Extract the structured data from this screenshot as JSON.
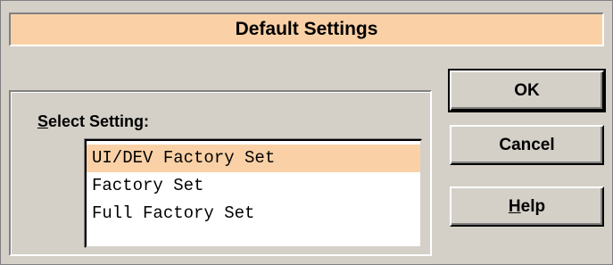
{
  "dialog": {
    "title": "Default Settings"
  },
  "select": {
    "label_mnemonic": "S",
    "label_rest": "elect Setting:",
    "items": [
      {
        "label": "UI/DEV Factory Set",
        "selected": true
      },
      {
        "label": "Factory Set",
        "selected": false
      },
      {
        "label": "Full Factory Set",
        "selected": false
      }
    ]
  },
  "buttons": {
    "ok": "OK",
    "cancel": "Cancel",
    "help_mnemonic": "H",
    "help_rest": "elp"
  },
  "colors": {
    "accent": "#fad1a6",
    "dialog_face": "#d4d0c8"
  }
}
